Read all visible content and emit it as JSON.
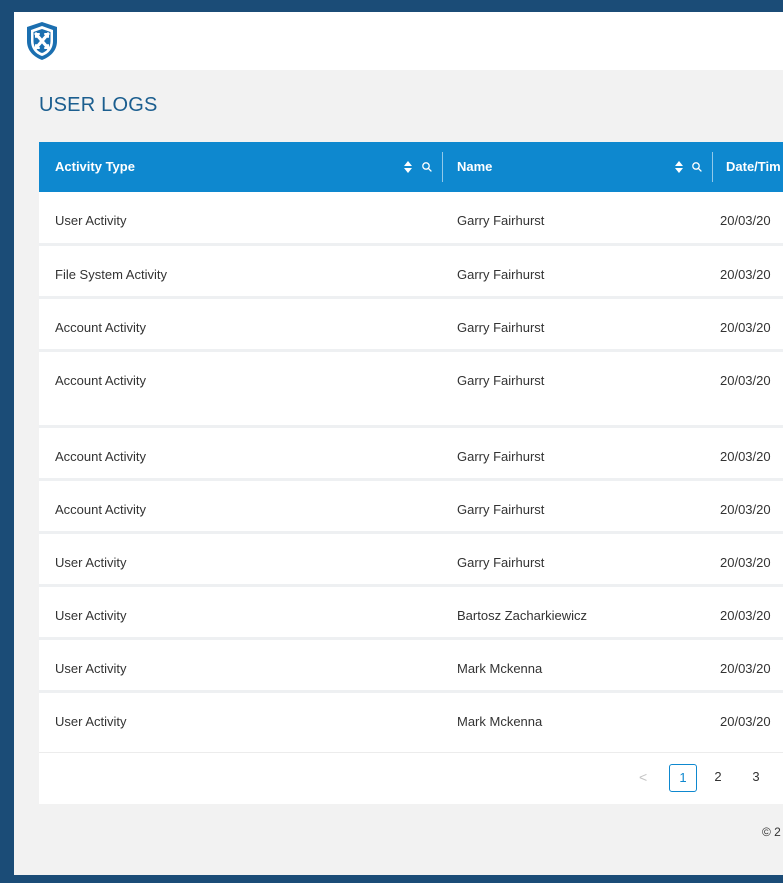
{
  "brand": {
    "logo_icon": "shield-x-logo-icon",
    "colors": {
      "primary": "#0e88cf",
      "frame": "#1b4c77",
      "title": "#1b5e8f"
    }
  },
  "page": {
    "title": "USER LOGS"
  },
  "table": {
    "columns": [
      {
        "label": "Activity Type",
        "sortable": true,
        "searchable": true
      },
      {
        "label": "Name",
        "sortable": true,
        "searchable": true
      },
      {
        "label": "Date/Tim"
      }
    ],
    "rows": [
      {
        "activity": "User Activity",
        "name": "Garry Fairhurst",
        "date": "20/03/20"
      },
      {
        "activity": "File System Activity",
        "name": "Garry Fairhurst",
        "date": "20/03/20"
      },
      {
        "activity": "Account Activity",
        "name": "Garry Fairhurst",
        "date": "20/03/20"
      },
      {
        "activity": "Account Activity",
        "name": "Garry Fairhurst",
        "date": "20/03/20"
      },
      {
        "activity": "Account Activity",
        "name": "Garry Fairhurst",
        "date": "20/03/20"
      },
      {
        "activity": "Account Activity",
        "name": "Garry Fairhurst",
        "date": "20/03/20"
      },
      {
        "activity": "User Activity",
        "name": "Garry Fairhurst",
        "date": "20/03/20"
      },
      {
        "activity": "User Activity",
        "name": "Bartosz Zacharkiewicz",
        "date": "20/03/20"
      },
      {
        "activity": "User Activity",
        "name": "Mark Mckenna",
        "date": "20/03/20"
      },
      {
        "activity": "User Activity",
        "name": "Mark Mckenna",
        "date": "20/03/20"
      }
    ]
  },
  "pagination": {
    "prev_icon": "chevron-left-icon",
    "prev_glyph": "<",
    "pages": [
      "1",
      "2",
      "3"
    ],
    "current": "1"
  },
  "footer": {
    "text": "© 2"
  }
}
